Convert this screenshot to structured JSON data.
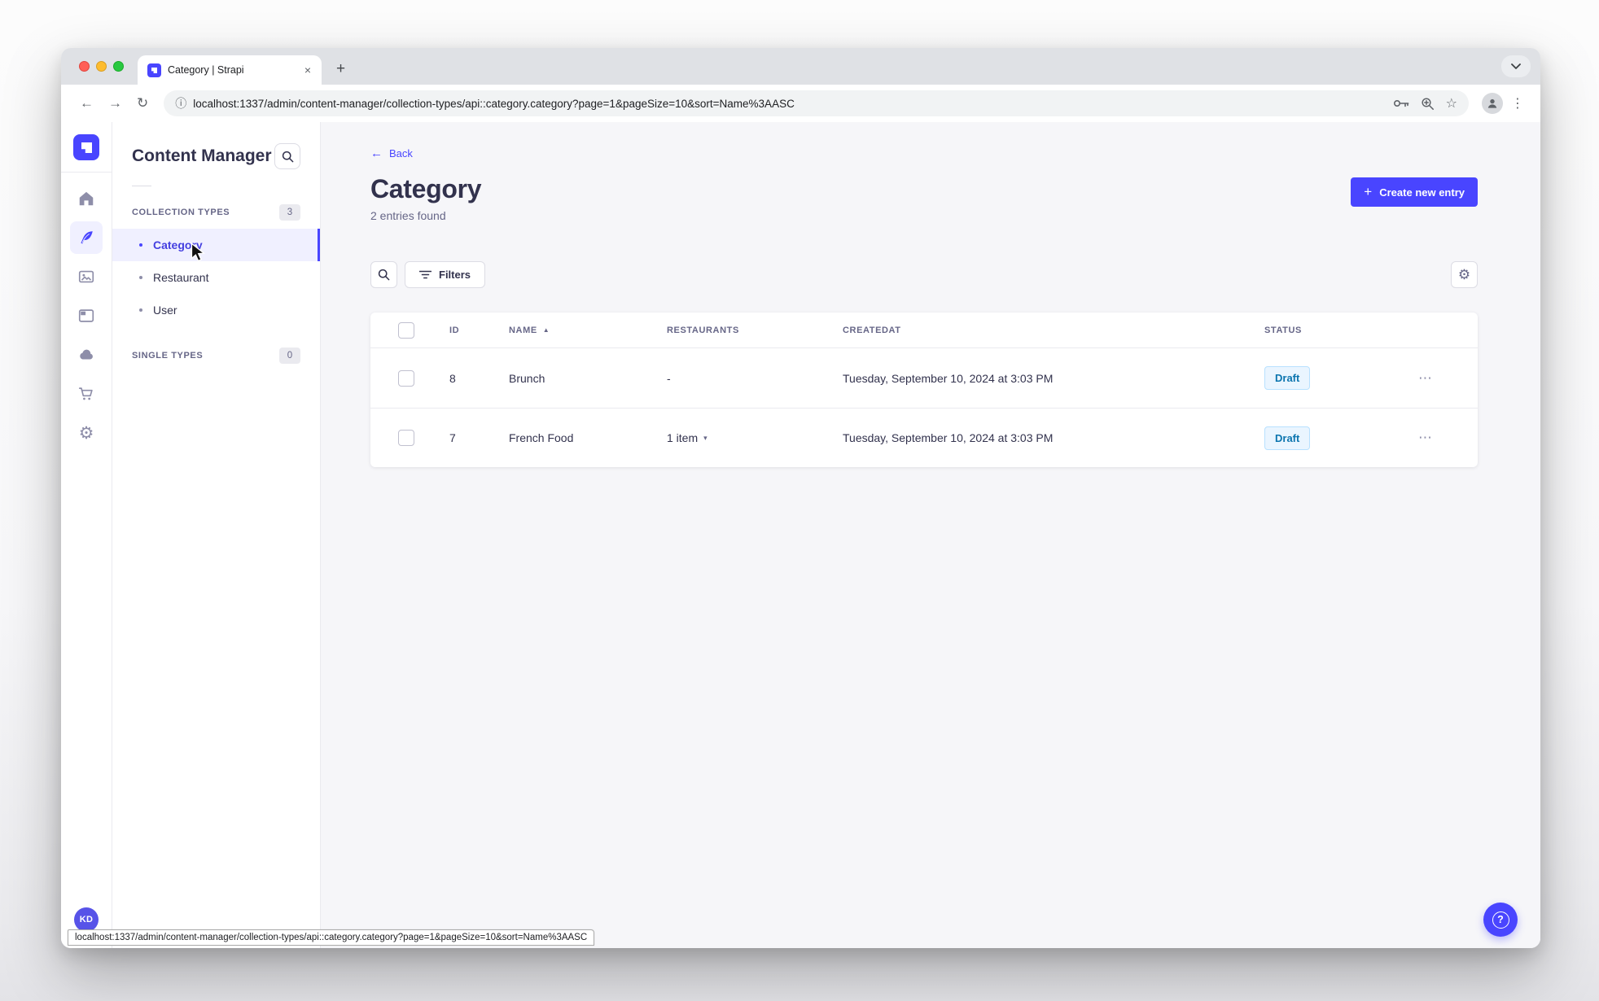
{
  "colors": {
    "accent": "#4945FF",
    "main_bg": "#F6F6F9",
    "draft_bg": "#EAF5FF",
    "draft_text": "#0C75AF",
    "active_item_bg": "#F0F0FF"
  },
  "browser": {
    "tab_title": "Category | Strapi",
    "close_tab_glyph": "×",
    "new_tab_glyph": "+",
    "back_glyph": "←",
    "forward_glyph": "→",
    "reload_glyph": "↻",
    "info_glyph": "ⓘ",
    "star_glyph": "☆",
    "menu_glyph": "⋮",
    "url": "localhost:1337/admin/content-manager/collection-types/api::category.category?page=1&pageSize=10&sort=Name%3AASC",
    "status_bar_url": "localhost:1337/admin/content-manager/collection-types/api::category.category?page=1&pageSize=10&sort=Name%3AASC"
  },
  "rail": {
    "gear_glyph": "⚙",
    "avatar_initials": "KD"
  },
  "panel": {
    "title": "Content Manager",
    "collection_types": {
      "label": "COLLECTION TYPES",
      "badge": "3",
      "items": [
        {
          "label": "Category"
        },
        {
          "label": "Restaurant"
        },
        {
          "label": "User"
        }
      ]
    },
    "single_types": {
      "label": "SINGLE TYPES",
      "badge": "0"
    }
  },
  "main": {
    "back_label": "Back",
    "back_glyph": "←",
    "title": "Category",
    "subtitle": "2 entries found",
    "create_button": {
      "plus_glyph": "+",
      "label": "Create new entry"
    },
    "filters_label": "Filters",
    "table": {
      "columns": {
        "id": "ID",
        "name": "NAME",
        "restaurants": "RESTAURANTS",
        "createdat": "CREATEDAT",
        "status": "STATUS"
      },
      "sort_glyph": "▲",
      "caret_glyph": "▾",
      "row_menu_glyph": "⋯",
      "rows": [
        {
          "id": "8",
          "name": "Brunch",
          "restaurants": "-",
          "created_at": "Tuesday, September 10, 2024 at 3:03 PM",
          "status": "Draft"
        },
        {
          "id": "7",
          "name": "French Food",
          "restaurants": "1 item",
          "created_at": "Tuesday, September 10, 2024 at 3:03 PM",
          "status": "Draft"
        }
      ]
    }
  },
  "help": {
    "glyph": "?"
  }
}
